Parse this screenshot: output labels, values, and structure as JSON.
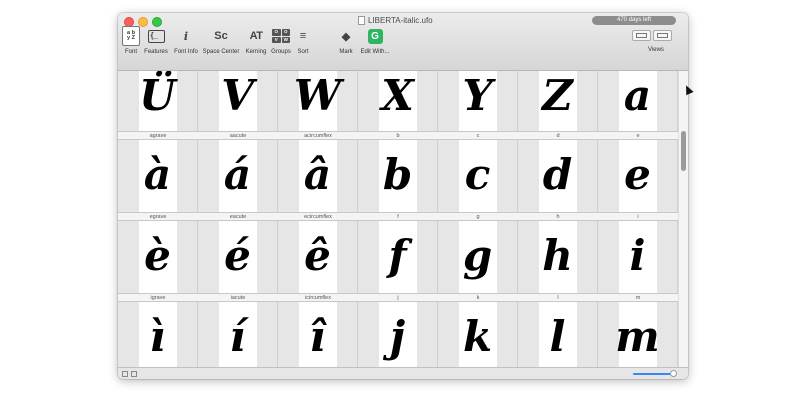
{
  "window": {
    "title": "LIBERTA-italic.ufo",
    "days_left": "470 days left"
  },
  "toolbar": {
    "font": {
      "label": "Font",
      "icon_text": [
        "a b",
        "y Z"
      ]
    },
    "features": {
      "label": "Features",
      "icon_text": "{_"
    },
    "font_info": {
      "label": "Font Info",
      "icon_text": "i"
    },
    "space_center": {
      "label": "Space Center",
      "icon_text": "Sc"
    },
    "kerning": {
      "label": "Kerning",
      "icon_text": "AT"
    },
    "groups": {
      "label": "Groups",
      "icon_text": [
        "O",
        "O",
        "V",
        "W"
      ]
    },
    "sort": {
      "label": "Sort",
      "icon_text": "≡"
    },
    "mark": {
      "label": "Mark",
      "icon_text": "◆"
    },
    "edit_with": {
      "label": "Edit With...",
      "icon_text": "G"
    },
    "views": {
      "label": "Views"
    }
  },
  "grid": {
    "rows": [
      {
        "glyphs": [
          "Ü",
          "V",
          "W",
          "X",
          "Y",
          "Z",
          "a"
        ],
        "names": [
          "agrave",
          "aacute",
          "acircumflex",
          "b",
          "c",
          "d",
          "e"
        ]
      },
      {
        "glyphs": [
          "à",
          "á",
          "â",
          "b",
          "c",
          "d",
          "e"
        ],
        "names": [
          "egrave",
          "eacute",
          "ecircumflex",
          "f",
          "g",
          "h",
          "i"
        ]
      },
      {
        "glyphs": [
          "è",
          "é",
          "ê",
          "f",
          "g",
          "h",
          "i"
        ],
        "names": [
          "igrave",
          "iacute",
          "icircumflex",
          "j",
          "k",
          "l",
          "m"
        ]
      },
      {
        "glyphs": [
          "ì",
          "í",
          "î",
          "j",
          "k",
          "l",
          "m"
        ],
        "names": []
      }
    ]
  },
  "colors": {
    "accent": "#3b86f7",
    "close": "#fc605c",
    "minimize": "#fdbc40",
    "zoom": "#34c84a"
  },
  "icons": {
    "font": "font-collection-icon",
    "features": "features-bracket-icon",
    "font_info": "info-icon",
    "space_center": "space-center-icon",
    "kerning": "kerning-icon",
    "groups": "groups-icon",
    "sort": "sort-icon",
    "mark": "paint-bucket-icon",
    "edit_with": "glyphs-app-icon",
    "views": "view-toggle-icon"
  }
}
